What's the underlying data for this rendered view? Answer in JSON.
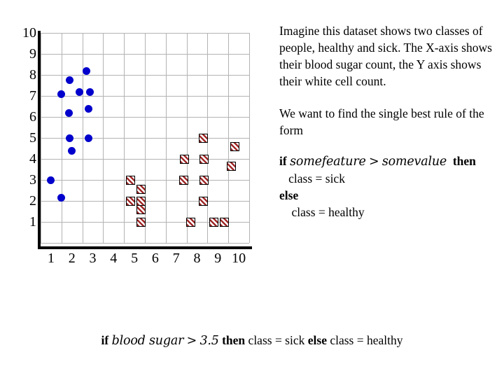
{
  "chart_data": {
    "type": "scatter",
    "title": "",
    "xlabel": "blood sugar",
    "ylabel": "white cell count",
    "xlim": [
      0,
      10
    ],
    "ylim": [
      0,
      10
    ],
    "grid": true,
    "legend_position": "none",
    "x_ticks": [
      "1",
      "2",
      "3",
      "4",
      "5",
      "6",
      "7",
      "8",
      "9",
      "10"
    ],
    "y_ticks": [
      "1",
      "2",
      "3",
      "4",
      "5",
      "6",
      "7",
      "8",
      "9",
      "10"
    ],
    "series": [
      {
        "name": "healthy",
        "marker": "circle",
        "color": "#0000cc",
        "points": [
          [
            0.5,
            3.0
          ],
          [
            1.0,
            2.15
          ],
          [
            1.0,
            7.1
          ],
          [
            1.35,
            6.2
          ],
          [
            1.4,
            7.75
          ],
          [
            1.4,
            5.0
          ],
          [
            1.5,
            4.4
          ],
          [
            1.85,
            7.2
          ],
          [
            2.2,
            8.2
          ],
          [
            2.35,
            7.2
          ],
          [
            2.3,
            6.4
          ],
          [
            2.3,
            5.0
          ]
        ]
      },
      {
        "name": "sick",
        "marker": "hatched-square",
        "color": "#a02929",
        "points": [
          [
            4.3,
            3.0
          ],
          [
            4.3,
            2.0
          ],
          [
            4.8,
            2.55
          ],
          [
            4.8,
            2.0
          ],
          [
            4.8,
            1.6
          ],
          [
            4.8,
            1.0
          ],
          [
            6.9,
            4.0
          ],
          [
            6.85,
            3.0
          ],
          [
            7.2,
            1.0
          ],
          [
            7.8,
            5.0
          ],
          [
            7.85,
            4.0
          ],
          [
            7.85,
            3.0
          ],
          [
            7.8,
            2.0
          ],
          [
            8.3,
            1.0
          ],
          [
            8.8,
            1.0
          ],
          [
            9.3,
            4.6
          ],
          [
            9.15,
            3.65
          ]
        ]
      }
    ]
  },
  "narrative": {
    "explanation": "Imagine this dataset shows two classes of people, healthy and sick. The X-axis shows their blood sugar count, the Y axis shows their white cell count.",
    "goal": "We want to find the single best rule of the form"
  },
  "rule_generic": {
    "if_keyword": "if",
    "feature": "somefeature",
    "operator": ">",
    "value": "somevalue",
    "then_keyword": "then",
    "then_body": "class = sick",
    "else_keyword": "else",
    "else_body": "class = healthy"
  },
  "rule_final": {
    "if_keyword": "if",
    "feature": "blood sugar",
    "operator": ">",
    "value": "3.5",
    "then_keyword": "then",
    "then_body": "class = sick",
    "else_keyword": "else",
    "else_body": "class = healthy"
  },
  "colors": {
    "healthy": "#0000cc",
    "sick": "#a02929",
    "grid": "#b3b3b3",
    "axis": "#000000",
    "background": "#ffffff"
  }
}
